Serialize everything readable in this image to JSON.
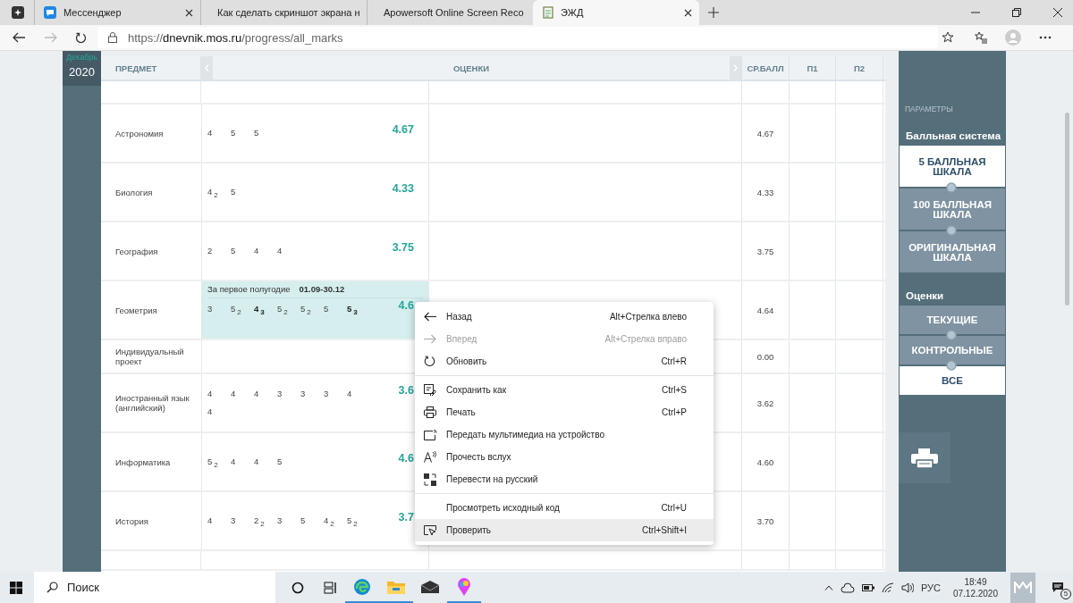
{
  "browser": {
    "tabs": [
      {
        "title": "Мессенджер",
        "selected": false
      },
      {
        "title": "Как сделать скриншот экрана н",
        "selected": false
      },
      {
        "title": "Apowersoft Online Screen Reco",
        "selected": false
      },
      {
        "title": "ЭЖД",
        "selected": true
      }
    ],
    "url": {
      "scheme": "https://",
      "host": "dnevnik.mos.ru",
      "path": "/progress/all_marks"
    }
  },
  "calendar": {
    "month": "Декабрь",
    "year": "2020"
  },
  "table": {
    "columns": [
      "ПРЕДМЕТ",
      "ОЦЕНКИ",
      "СР.БАЛЛ",
      "П1",
      "П2"
    ],
    "rows": [
      {
        "subject": "Астрономия",
        "marks": [
          {
            "value": "4",
            "bold": false
          },
          {
            "value": "5",
            "bold": false
          },
          {
            "value": "5",
            "bold": false
          }
        ],
        "marks_average": "4.67",
        "average": "4.67"
      },
      {
        "subject": "Биология",
        "marks": [
          {
            "value": "4",
            "weight": "2",
            "bold": false
          },
          {
            "value": "5",
            "bold": false
          }
        ],
        "marks_average": "4.33",
        "average": "4.33"
      },
      {
        "subject": "География",
        "marks": [
          {
            "value": "2",
            "bold": false
          },
          {
            "value": "5",
            "bold": false
          },
          {
            "value": "4",
            "bold": false
          },
          {
            "value": "4",
            "bold": false
          }
        ],
        "marks_average": "3.75",
        "average": "3.75"
      },
      {
        "subject": "Геометрия",
        "period": {
          "label": "За первое полугодие",
          "dates": "01.09-30.12"
        },
        "marks": [
          {
            "value": "3",
            "bold": false
          },
          {
            "value": "5",
            "weight": "2",
            "bold": false
          },
          {
            "value": "4",
            "weight": "3",
            "bold": true
          },
          {
            "value": "5",
            "weight": "2",
            "bold": false
          },
          {
            "value": "5",
            "weight": "2",
            "bold": false
          },
          {
            "value": "5",
            "bold": false
          },
          {
            "value": "5",
            "weight": "3",
            "bold": true
          }
        ],
        "marks_average": "4.6",
        "average": "4.64"
      },
      {
        "subject": "Индивидуальный проект",
        "average": "0.00"
      },
      {
        "subject": "Иностранный язык (английский)",
        "marks": [
          {
            "value": "4",
            "bold": false
          },
          {
            "value": "4",
            "bold": false
          },
          {
            "value": "4",
            "bold": false
          },
          {
            "value": "3",
            "bold": false
          },
          {
            "value": "3",
            "bold": false
          },
          {
            "value": "3",
            "bold": false
          },
          {
            "value": "4",
            "bold": false
          },
          {
            "value": "4",
            "bold": false
          }
        ],
        "marks_average": "3.6",
        "average": "3.62"
      },
      {
        "subject": "Информатика",
        "marks": [
          {
            "value": "5",
            "weight": "2",
            "bold": false
          },
          {
            "value": "4",
            "bold": false
          },
          {
            "value": "4",
            "bold": false
          },
          {
            "value": "5",
            "bold": false
          }
        ],
        "marks_average": "4.6",
        "average": "4.60"
      },
      {
        "subject": "История",
        "marks": [
          {
            "value": "4",
            "bold": false
          },
          {
            "value": "3",
            "bold": false
          },
          {
            "value": "2",
            "weight": "2",
            "bold": false
          },
          {
            "value": "3",
            "bold": false
          },
          {
            "value": "5",
            "bold": false
          },
          {
            "value": "4",
            "weight": "2",
            "bold": false
          },
          {
            "value": "5",
            "weight": "2",
            "bold": false
          }
        ],
        "marks_average": "3.7",
        "average": "3.70"
      }
    ]
  },
  "parameters": {
    "title": "ПАРАМЕТРЫ",
    "groups": [
      {
        "label": "Балльная система",
        "options": [
          {
            "label": "5 БАЛЛЬНАЯ ШКАЛА",
            "selected": true
          },
          {
            "label": "100 БАЛЛЬНАЯ ШКАЛА",
            "selected": false
          },
          {
            "label": "ОРИГИНАЛЬНАЯ ШКАЛА",
            "selected": false
          }
        ]
      },
      {
        "label": "Оценки",
        "options": [
          {
            "label": "ТЕКУЩИЕ",
            "selected": false
          },
          {
            "label": "КОНТРОЛЬНЫЕ",
            "selected": false
          },
          {
            "label": "ВСЕ",
            "selected": true
          }
        ]
      }
    ]
  },
  "context_menu": {
    "groups": [
      {
        "items": [
          {
            "label": "Назад",
            "shortcut": "Alt+Стрелка влево",
            "disabled": false,
            "highlighted": false
          },
          {
            "label": "Вперед",
            "shortcut": "Alt+Стрелка вправо",
            "disabled": true,
            "highlighted": false
          },
          {
            "label": "Обновить",
            "shortcut": "Ctrl+R",
            "disabled": false,
            "highlighted": false
          }
        ]
      },
      {
        "items": [
          {
            "label": "Сохранить как",
            "shortcut": "Ctrl+S",
            "disabled": false,
            "highlighted": false
          },
          {
            "label": "Печать",
            "shortcut": "Ctrl+P",
            "disabled": false,
            "highlighted": false
          },
          {
            "label": "Передать мультимедиа на устройство",
            "disabled": false,
            "highlighted": false
          },
          {
            "label": "Прочесть вслух",
            "disabled": false,
            "highlighted": false
          },
          {
            "label": "Перевести на русский",
            "disabled": false,
            "highlighted": false
          }
        ]
      },
      {
        "items": [
          {
            "label": "Просмотреть исходный код",
            "shortcut": "Ctrl+U",
            "disabled": false,
            "highlighted": false
          },
          {
            "label": "Проверить",
            "shortcut": "Ctrl+Shift+I",
            "disabled": false,
            "highlighted": true
          }
        ]
      }
    ]
  },
  "taskbar": {
    "search_placeholder": "Поиск",
    "apps": [
      {
        "running": true
      },
      {
        "running": true
      },
      {
        "running": false
      },
      {
        "running": true
      }
    ],
    "language": "РУС",
    "time": "18:49",
    "date": "07.12.2020",
    "notifications": "5"
  }
}
